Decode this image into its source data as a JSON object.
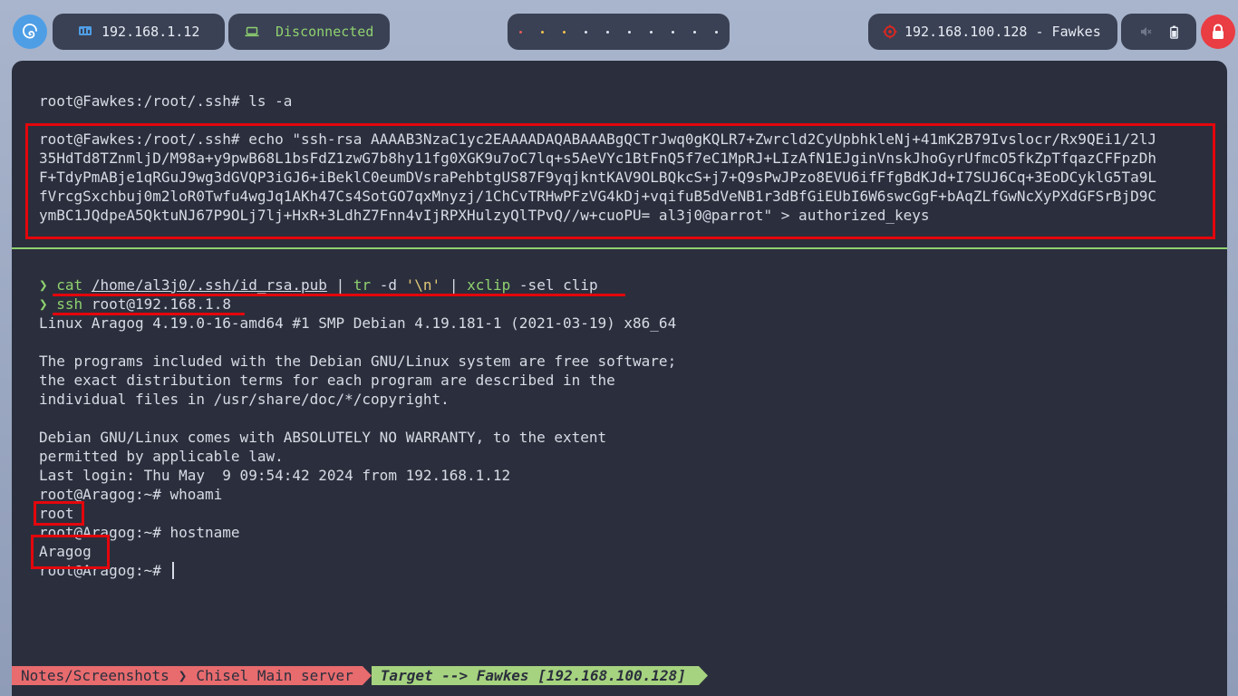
{
  "topbar": {
    "ip_local": "192.168.1.12",
    "vpn_status": "Disconnected",
    "workspaces": [
      {
        "color": "#e55b57"
      },
      {
        "color": "#f1c24f"
      },
      {
        "color": "#f1c24f"
      },
      {
        "color": "#dfe5ef"
      },
      {
        "color": "#dfe5ef"
      },
      {
        "color": "#dfe5ef"
      },
      {
        "color": "#dfe5ef"
      },
      {
        "color": "#dfe5ef"
      },
      {
        "color": "#dfe5ef"
      },
      {
        "color": "#dfe5ef"
      }
    ],
    "target": "192.168.100.128 - Fawkes",
    "icons": [
      "debian-logo-icon",
      "network-icon",
      "laptop-icon",
      "target-icon",
      "mute-icon",
      "battery-icon",
      "lock-icon"
    ],
    "accent": "#8fd16f"
  },
  "terminal_top": {
    "line1": "root@Fawkes:/root/.ssh# ls -a",
    "echo_lines": [
      "root@Fawkes:/root/.ssh# echo \"ssh-rsa AAAAB3NzaC1yc2EAAAADAQABAAABgQCTrJwq0gKQLR7+Zwrcld2CyUpbhkleNj+41mK2B79Ivslocr/Rx9QEi1/2lJ",
      "35HdTd8TZnmljD/M98a+y9pwB68L1bsFdZ1zwG7b8hy11fg0XGK9u7oC7lq+s5AeVYc1BtFnQ5f7eC1MpRJ+LIzAfN1EJginVnskJhoGyrUfmcO5fkZpTfqazCFFpzDh",
      "F+TdyPmABje1qRGuJ9wg3dGVQP3iGJ6+iBeklC0eumDVsraPehbtgUS87F9yqjkntKAV9OLBQkcS+j7+Q9sPwJPzo8EVU6ifFfgBdKJd+I7SUJ6Cq+3EoDCyklG5Ta9L",
      "fVrcgSxchbuj0m2loR0Twfu4wgJq1AKh47Cs4SotGO7qxMnyzj/1ChCvTRHwPFzVG4kDj+vqifuB5dVeNB1r3dBfGiEUbI6W6swcGgF+bAqZLfGwNcXyPXdGFSrBjD9C",
      "ymBC1JQdpeA5QktuNJ67P9OLj7lj+HxR+3LdhZ7Fnn4vIjRPXHulzyQlTPvQ//w+cuoPU= al3j0@parrot\" > authorized_keys"
    ]
  },
  "terminal_bottom": {
    "cmd1": {
      "arrow": "❯",
      "cmd": "cat",
      "path": "/home/al3j0/.ssh/id_rsa.pub",
      "pipe1": "|",
      "cmd2": "tr",
      "opt": "-d",
      "str": "'\\n'",
      "pipe2": "|",
      "cmd3": "xclip",
      "args": "-sel clip"
    },
    "cmd2": {
      "arrow": "❯",
      "cmd": "ssh",
      "args": "root@192.168.1.8"
    },
    "output": [
      "Linux Aragog 4.19.0-16-amd64 #1 SMP Debian 4.19.181-1 (2021-03-19) x86_64",
      "",
      "The programs included with the Debian GNU/Linux system are free software;",
      "the exact distribution terms for each program are described in the",
      "individual files in /usr/share/doc/*/copyright.",
      "",
      "Debian GNU/Linux comes with ABSOLUTELY NO WARRANTY, to the extent",
      "permitted by applicable law.",
      "Last login: Thu May  9 09:54:42 2024 from 192.168.1.12",
      "root@Aragog:~# whoami",
      "root",
      "root@Aragog:~# hostname",
      "Aragog",
      "root@Aragog:~# "
    ]
  },
  "statusbar": {
    "seg1": "Notes/Screenshots",
    "seg2": "Chisel Main server",
    "seg3": "Target --> Fawkes [192.168.100.128]"
  }
}
